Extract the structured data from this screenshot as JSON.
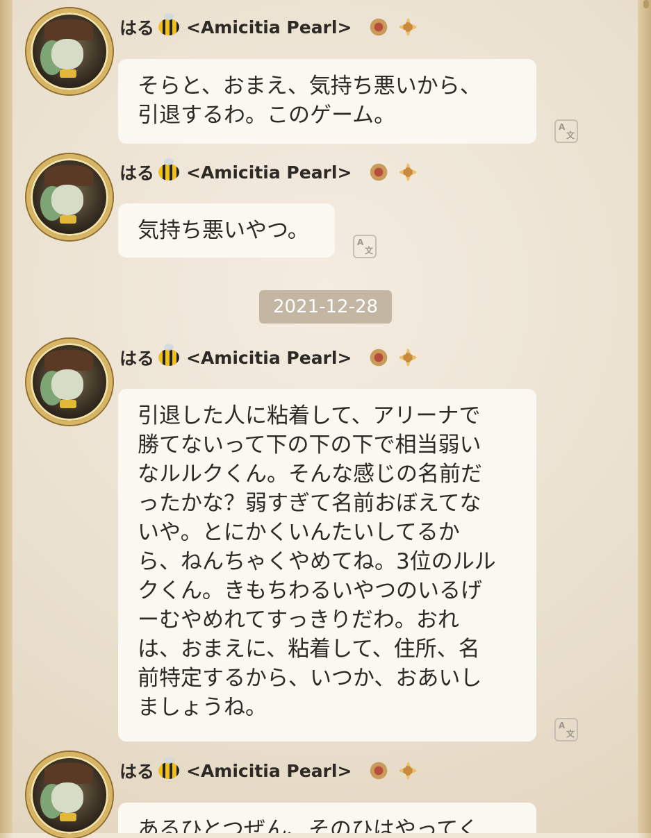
{
  "date_separator": "2021-12-28",
  "sender": {
    "name": "はる",
    "guild": "<Amicitia Pearl>"
  },
  "icons": {
    "bee": "bee-emoji-icon",
    "badge_1": "rank-badge-icon",
    "badge_2": "crest-badge-icon",
    "translate": "translate-icon"
  },
  "messages": [
    {
      "text": "そらと、おまえ、気持ち悪いから、\n引退するわ。このゲーム。"
    },
    {
      "text": "気持ち悪いやつ。"
    },
    {
      "text": "引退した人に粘着して、アリーナで\n勝てないって下の下の下で相当弱い\nなルルクくん。そんな感じの名前だ\nったかな？弱すぎて名前おぼえてな\nいや。とにかくいんたいしてるか\nら、ねんちゃくやめてね。3位のルル\nクくん。きもちわるいやつのいるげ\nーむやめれてすっきりだわ。おれ\nは、おまえに、粘着して、住所、名\n前特定するから、いつか、おあいし\nましょうね。"
    },
    {
      "text": "あるひとつぜん、そのひはやってく"
    }
  ],
  "colors": {
    "bubble": "#fbf7f1",
    "background": "#efe6d6",
    "date_pill": "#c3b6a2",
    "avatar_border": "#d7b565"
  }
}
